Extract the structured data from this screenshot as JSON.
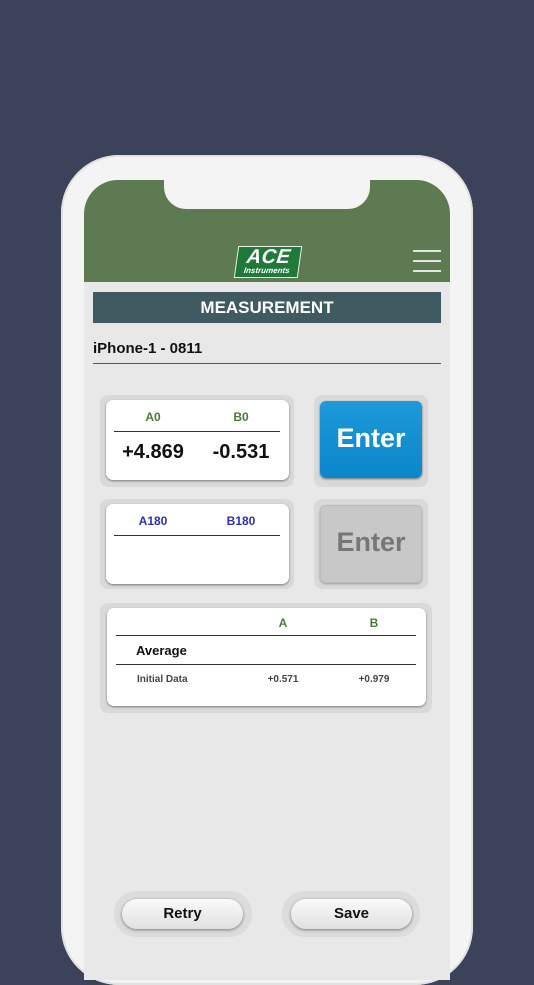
{
  "header": {
    "logo_primary": "ACE",
    "logo_secondary": "Instruments"
  },
  "page_title": "MEASUREMENT",
  "device_name": "iPhone-1 - 0811",
  "reading_0": {
    "col_a": "A0",
    "col_b": "B0",
    "value_a": "+4.869",
    "value_b": "-0.531",
    "enter_label": "Enter"
  },
  "reading_180": {
    "col_a": "A180",
    "col_b": "B180",
    "value_a": "",
    "value_b": "",
    "enter_label": "Enter"
  },
  "average_table": {
    "col_a": "A",
    "col_b": "B",
    "row_title": "Average",
    "rows": [
      {
        "label": "Initial Data",
        "a": "+0.571",
        "b": "+0.979"
      }
    ]
  },
  "actions": {
    "retry_label": "Retry",
    "save_label": "Save"
  },
  "colors": {
    "background": "#3b4259",
    "header_green": "#5e7a52",
    "title_bar": "#3f5a60",
    "green_heading": "#4a7a3a",
    "blue_heading": "#2b2fb5",
    "enter_active": "#1296d6"
  }
}
